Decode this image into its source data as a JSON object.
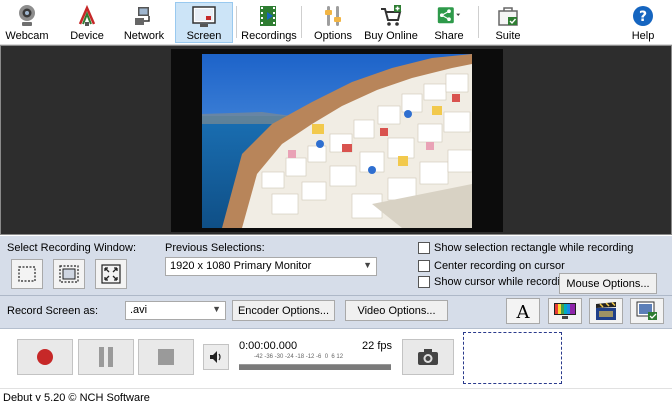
{
  "toolbar": {
    "items": [
      {
        "label": "Webcam",
        "icon": "webcam-icon"
      },
      {
        "label": "Device",
        "icon": "device-icon"
      },
      {
        "label": "Network",
        "icon": "network-icon"
      },
      {
        "label": "Screen",
        "icon": "screen-icon",
        "active": true
      },
      {
        "label": "Recordings",
        "icon": "film-icon"
      },
      {
        "label": "Options",
        "icon": "options-icon"
      },
      {
        "label": "Buy Online",
        "icon": "cart-icon"
      },
      {
        "label": "Share",
        "icon": "share-icon"
      },
      {
        "label": "Suite",
        "icon": "suite-icon"
      },
      {
        "label": "Help",
        "icon": "help-icon"
      }
    ]
  },
  "settings": {
    "select_window_label": "Select Recording Window:",
    "previous_selections_label": "Previous Selections:",
    "previous_selection_value": "1920 x 1080 Primary Monitor",
    "checkboxes": [
      {
        "label": "Show selection rectangle while recording",
        "checked": false
      },
      {
        "label": "Center recording on cursor",
        "checked": false
      },
      {
        "label": "Show cursor while recording",
        "checked": false
      }
    ],
    "mouse_options": "Mouse Options...",
    "record_as_label": "Record Screen as:",
    "format_value": ".avi",
    "encoder_options": "Encoder Options...",
    "video_options": "Video Options..."
  },
  "controls": {
    "time": "0:00:00.000",
    "fps": "22 fps",
    "meter_ticks": "-42 -36 -30 -24 -18 -12 -6  0  6 12"
  },
  "status": {
    "text": "Debut v 5.20 © NCH Software"
  },
  "colors": {
    "active_tab": "#cce4f7",
    "settings_bg": "#d6dde9",
    "record_red": "#c62828"
  }
}
